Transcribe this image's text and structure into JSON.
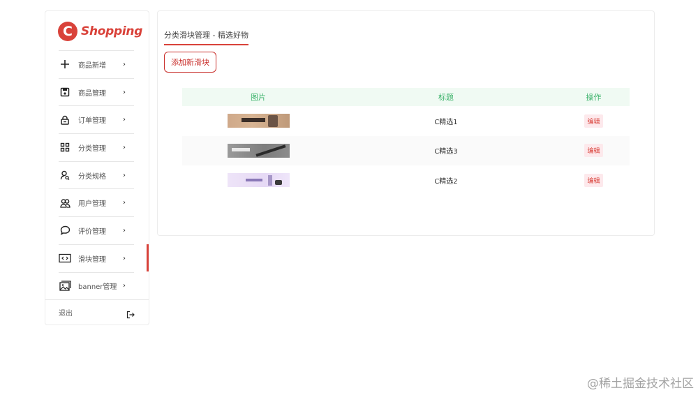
{
  "brand": {
    "logo_letter": "C",
    "name": "Shopping",
    "accent": "#d9423a"
  },
  "sidebar": {
    "items": [
      {
        "label": "商品新增",
        "icon": "plus-icon",
        "active": false
      },
      {
        "label": "商品管理",
        "icon": "save-icon",
        "active": false
      },
      {
        "label": "订单管理",
        "icon": "lock-icon",
        "active": false
      },
      {
        "label": "分类管理",
        "icon": "grid-icon",
        "active": false
      },
      {
        "label": "分类规格",
        "icon": "user-search-icon",
        "active": false
      },
      {
        "label": "用户管理",
        "icon": "users-icon",
        "active": false
      },
      {
        "label": "评价管理",
        "icon": "comment-icon",
        "active": false
      },
      {
        "label": "滑块管理",
        "icon": "code-icon",
        "active": true
      },
      {
        "label": "banner管理",
        "icon": "image-icon",
        "active": false
      }
    ],
    "logout_label": "退出"
  },
  "main": {
    "title": "分类滑块管理 - 精选好物",
    "add_button_label": "添加新滑块",
    "table": {
      "headers": [
        "图片",
        "标题",
        "操作"
      ],
      "rows": [
        {
          "title": "C精选1",
          "action": "编辑"
        },
        {
          "title": "C精选3",
          "action": "编辑"
        },
        {
          "title": "C精选2",
          "action": "编辑"
        }
      ]
    }
  },
  "watermark": "@稀土掘金技术社区"
}
